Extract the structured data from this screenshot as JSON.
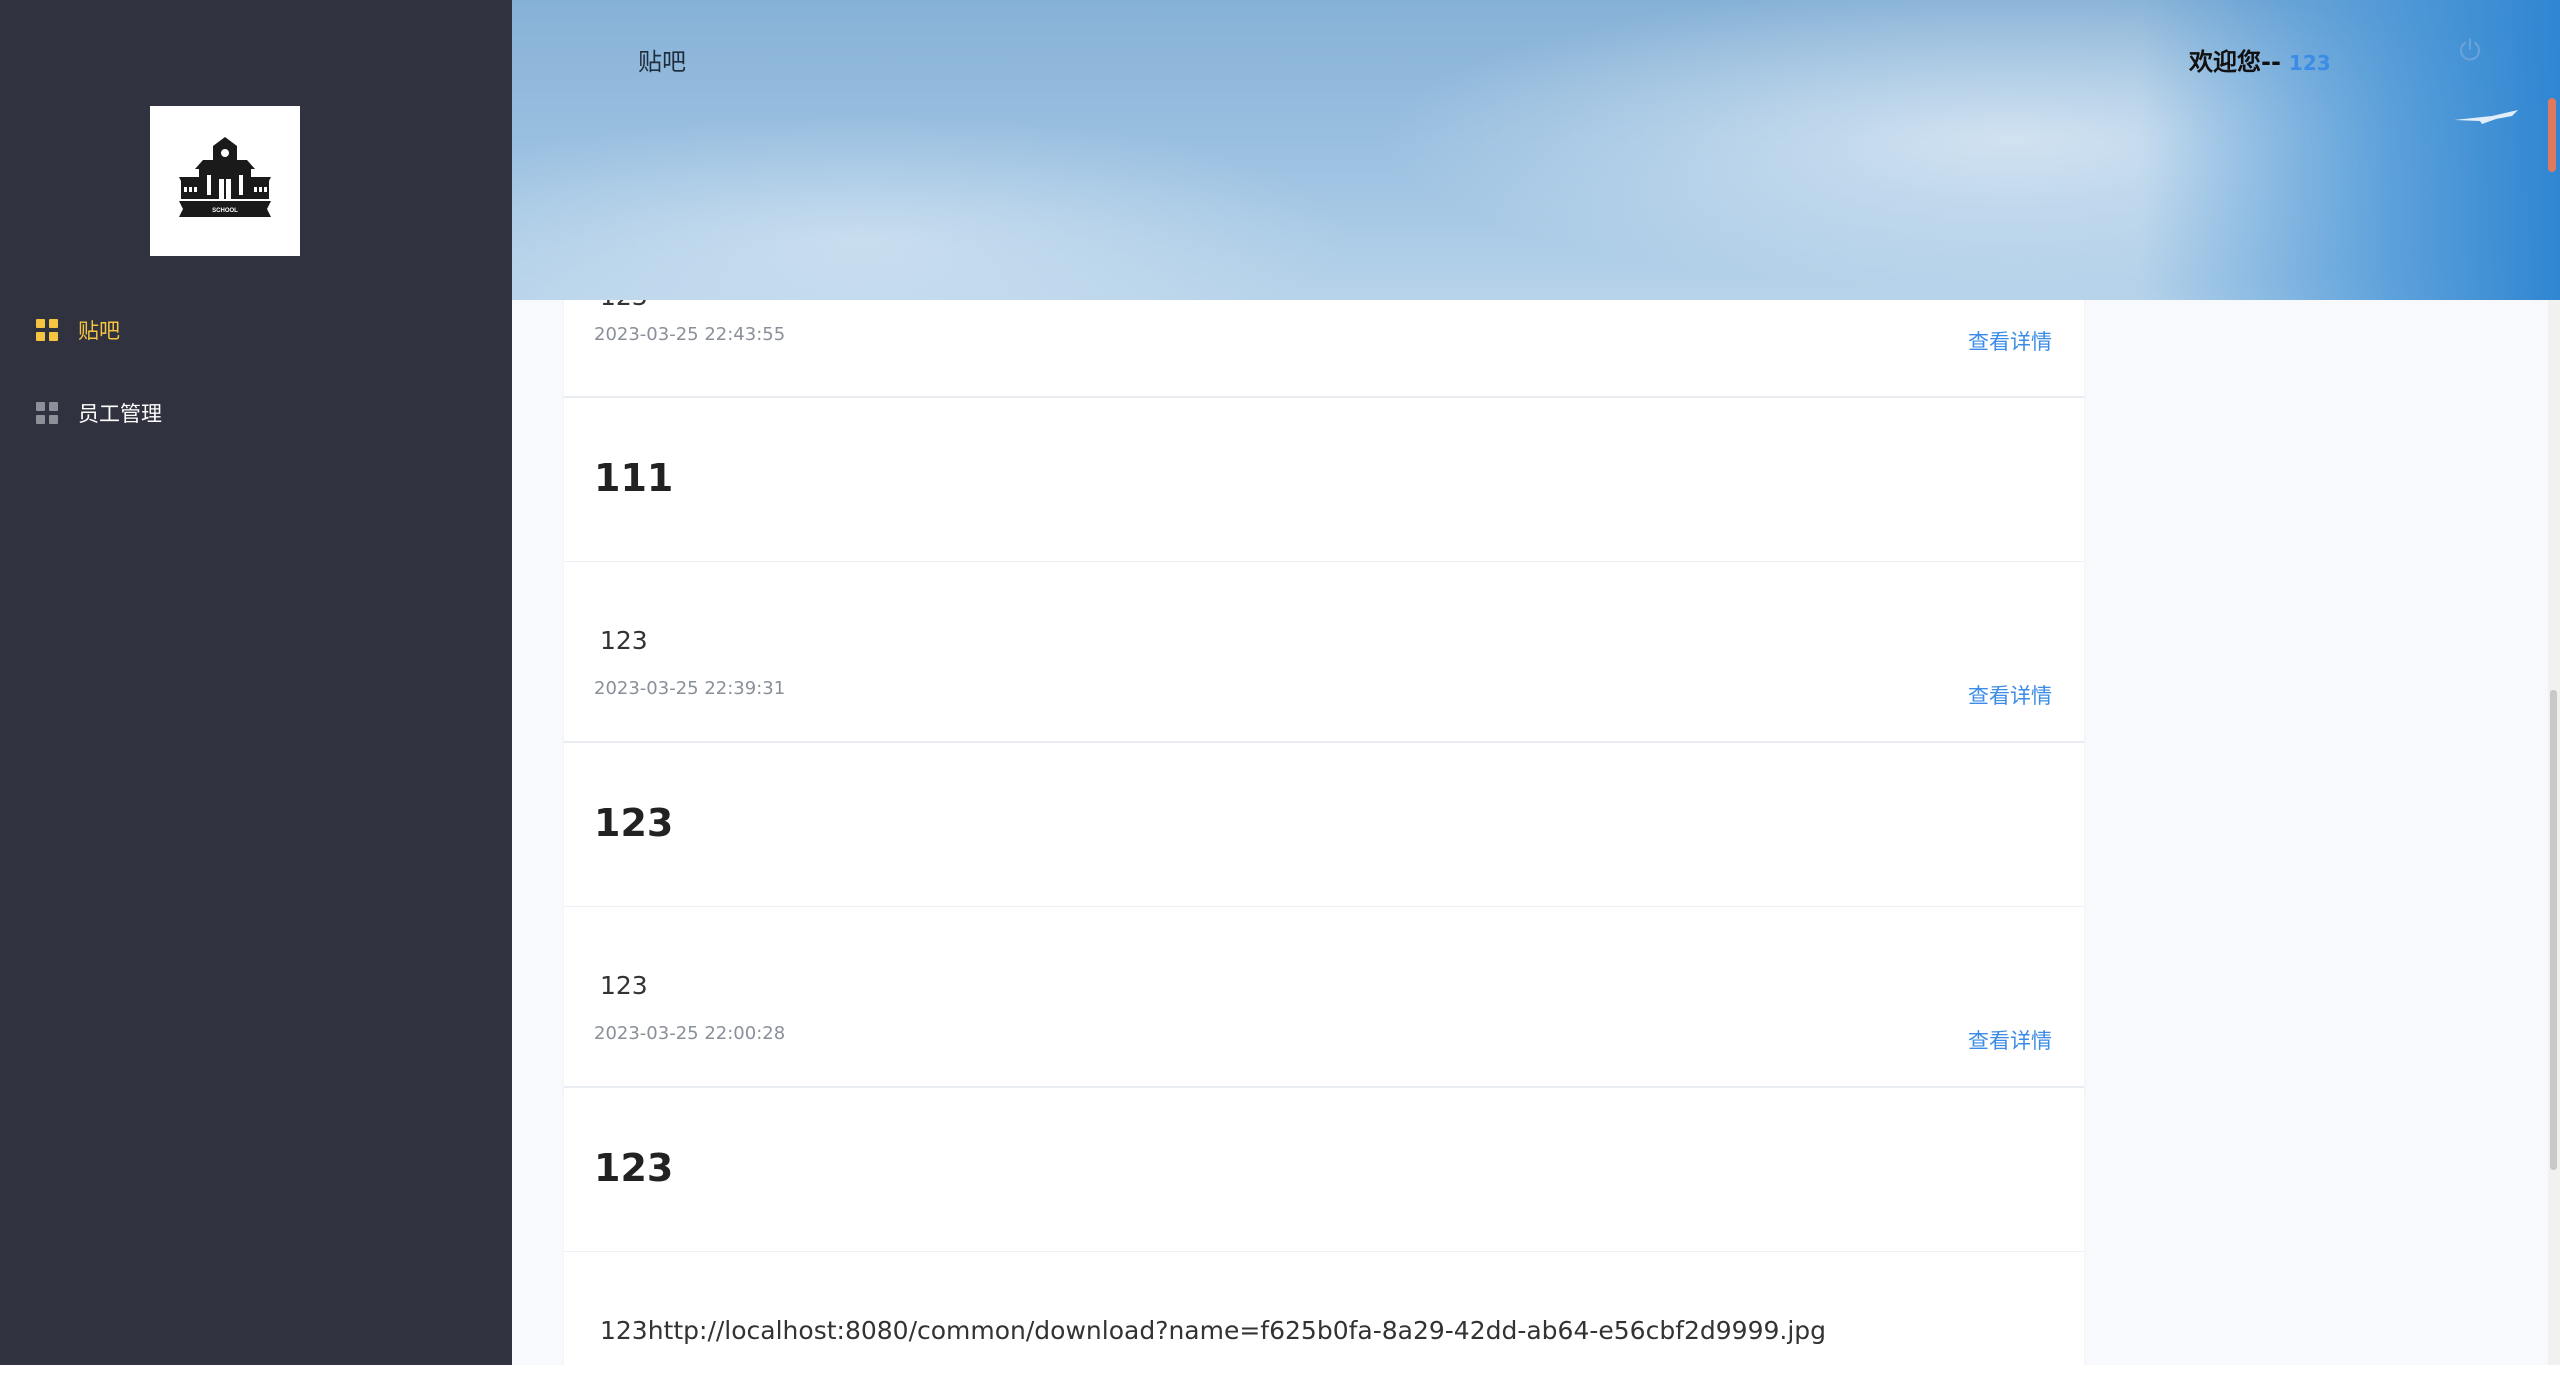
{
  "sidebar": {
    "logo_text": "SCHOOL",
    "items": [
      {
        "label": "贴吧",
        "active": true
      },
      {
        "label": "员工管理",
        "active": false
      }
    ]
  },
  "header": {
    "title": "贴吧",
    "welcome_label": "欢迎您--",
    "username": "123"
  },
  "posts": [
    {
      "title": "",
      "body": "123",
      "time": "2023-03-25 22:43:55",
      "link": "查看详情"
    },
    {
      "title": "111",
      "body": "123",
      "time": "2023-03-25 22:39:31",
      "link": "查看详情"
    },
    {
      "title": "123",
      "body": "123",
      "time": "2023-03-25 22:00:28",
      "link": "查看详情"
    },
    {
      "title": "123",
      "body": "123http://localhost:8080/common/download?name=f625b0fa-8a29-42dd-ab64-e56cbf2d9999.jpg",
      "time": "",
      "link": ""
    }
  ],
  "colors": {
    "sidebar_bg": "#30333f",
    "active_menu": "#f5c542",
    "link": "#3c8ce7"
  },
  "icons": {
    "logo": "school-building-icon",
    "menu": "grid-icon",
    "logout": "power-icon"
  }
}
